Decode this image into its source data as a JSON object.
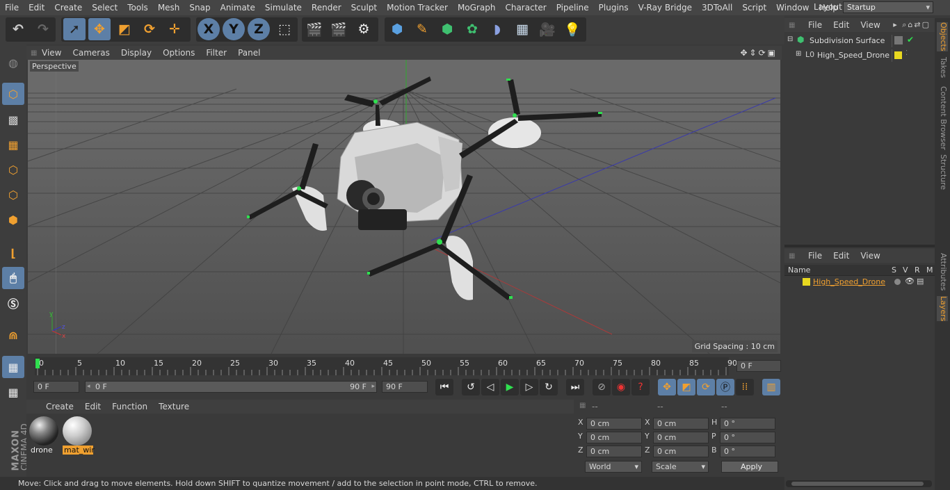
{
  "menu": [
    "File",
    "Edit",
    "Create",
    "Select",
    "Tools",
    "Mesh",
    "Snap",
    "Animate",
    "Simulate",
    "Render",
    "Sculpt",
    "Motion Tracker",
    "MoGraph",
    "Character",
    "Pipeline",
    "Plugins",
    "V-Ray Bridge",
    "3DToAll",
    "Script",
    "Window",
    "Help"
  ],
  "layout": {
    "label": "Layout:",
    "value": "Startup"
  },
  "toolbar": {
    "x": "X",
    "y": "Y",
    "z": "Z"
  },
  "viewport": {
    "menu": [
      "View",
      "Cameras",
      "Display",
      "Options",
      "Filter",
      "Panel"
    ],
    "label": "Perspective",
    "grid": "Grid Spacing : 10 cm"
  },
  "timeline": {
    "ticks": [
      "0",
      "5",
      "10",
      "15",
      "20",
      "25",
      "30",
      "35",
      "40",
      "45",
      "50",
      "55",
      "60",
      "65",
      "70",
      "75",
      "80",
      "85",
      "90"
    ],
    "current": "0 F"
  },
  "transport": {
    "start": "0 F",
    "range_start": "0 F",
    "range_end": "90 F",
    "end": "90 F"
  },
  "materials": {
    "menu": [
      "Create",
      "Edit",
      "Function",
      "Texture"
    ],
    "items": [
      {
        "name": "drone"
      },
      {
        "name": "mat_wir"
      }
    ]
  },
  "coords": {
    "headers": [
      "--",
      "--",
      "--"
    ],
    "rows": [
      [
        "X",
        "0 cm",
        "X",
        "0 cm",
        "H",
        "0 °"
      ],
      [
        "Y",
        "0 cm",
        "Y",
        "0 cm",
        "P",
        "0 °"
      ],
      [
        "Z",
        "0 cm",
        "Z",
        "0 cm",
        "B",
        "0 °"
      ]
    ],
    "world": "World",
    "scale": "Scale",
    "apply": "Apply"
  },
  "objects": {
    "menu": [
      "File",
      "Edit",
      "View"
    ],
    "items": [
      "Subdivision Surface",
      "High_Speed_Drone"
    ]
  },
  "layers": {
    "menu": [
      "File",
      "Edit",
      "View"
    ],
    "cols": [
      "Name",
      "S",
      "V",
      "R",
      "M"
    ],
    "items": [
      "High_Speed_Drone"
    ]
  },
  "sidetabs": [
    "Objects",
    "Takes",
    "Content Browser",
    "Structure",
    "Attributes",
    "Layers"
  ],
  "status": "Move: Click and drag to move elements. Hold down SHIFT to quantize movement / add to the selection in point mode, CTRL to remove.",
  "brand": [
    "MAXON",
    "CINEMA 4D"
  ],
  "colors": {
    "accent": "#f0a030",
    "layer_color": "#e8d820",
    "selected_tool": "#5d7fa6"
  }
}
